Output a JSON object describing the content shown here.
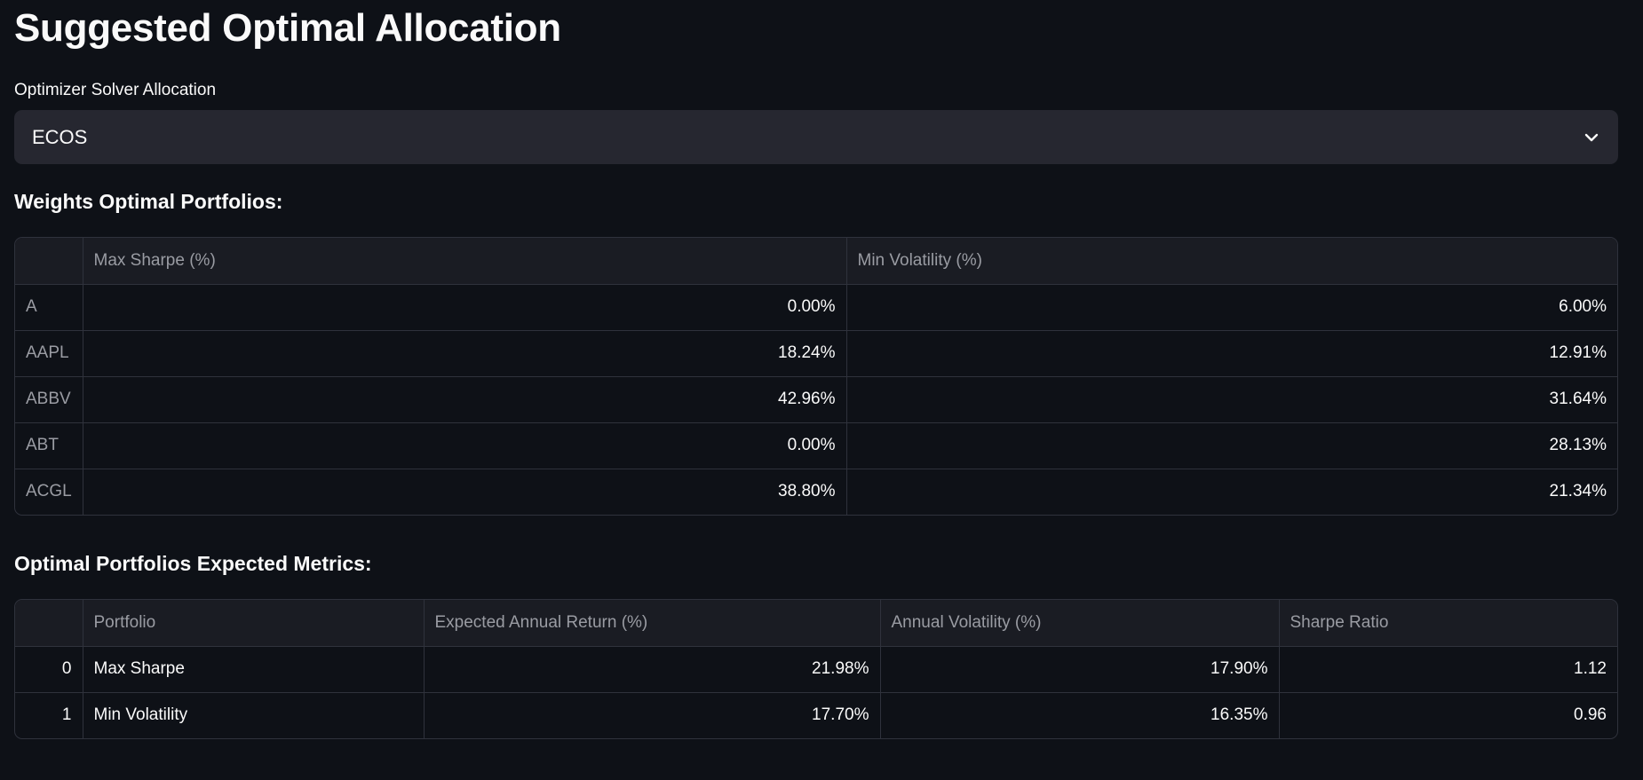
{
  "page": {
    "title": "Suggested Optimal Allocation"
  },
  "solver": {
    "label": "Optimizer Solver Allocation",
    "value": "ECOS",
    "icon": "chevron-down-icon"
  },
  "weights": {
    "heading": "Weights Optimal Portfolios:",
    "columns": [
      "",
      "Max Sharpe (%)",
      "Min Volatility (%)"
    ],
    "rows": [
      {
        "ticker": "A",
        "max_sharpe": "0.00%",
        "min_vol": "6.00%"
      },
      {
        "ticker": "AAPL",
        "max_sharpe": "18.24%",
        "min_vol": "12.91%"
      },
      {
        "ticker": "ABBV",
        "max_sharpe": "42.96%",
        "min_vol": "31.64%"
      },
      {
        "ticker": "ABT",
        "max_sharpe": "0.00%",
        "min_vol": "28.13%"
      },
      {
        "ticker": "ACGL",
        "max_sharpe": "38.80%",
        "min_vol": "21.34%"
      }
    ]
  },
  "metrics": {
    "heading": "Optimal Portfolios Expected Metrics:",
    "columns": [
      "",
      "Portfolio",
      "Expected Annual Return (%)",
      "Annual Volatility (%)",
      "Sharpe Ratio"
    ],
    "rows": [
      {
        "index": "0",
        "portfolio": "Max Sharpe",
        "return": "21.98%",
        "volatility": "17.90%",
        "sharpe": "1.12"
      },
      {
        "index": "1",
        "portfolio": "Min Volatility",
        "return": "17.70%",
        "volatility": "16.35%",
        "sharpe": "0.96"
      }
    ]
  },
  "colors": {
    "background": "#0e1117",
    "select_background": "#262730",
    "header_background": "#1a1c23",
    "border": "#2f323c",
    "text": "#fafafa",
    "muted_text": "#9a9ca3"
  }
}
